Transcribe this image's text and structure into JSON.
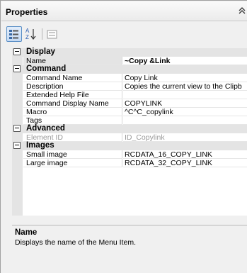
{
  "panel": {
    "title": "Properties"
  },
  "toolbar": {
    "categorized_icon": "categorized-view-icon",
    "alphabetical_icon": "sort-alphabetical-icon",
    "pages_icon": "property-pages-icon"
  },
  "categories": [
    {
      "label": "Display",
      "props": [
        {
          "name": "Name",
          "value": "~Copy &Link",
          "bold": true,
          "selected": true
        }
      ]
    },
    {
      "label": "Command",
      "props": [
        {
          "name": "Command Name",
          "value": "Copy Link"
        },
        {
          "name": "Description",
          "value": "Copies the current view to the Clipb"
        },
        {
          "name": "Extended Help File",
          "value": ""
        },
        {
          "name": "Command Display Name",
          "value": "COPYLINK"
        },
        {
          "name": "Macro",
          "value": "^C^C_copylink"
        },
        {
          "name": "Tags",
          "value": ""
        }
      ]
    },
    {
      "label": "Advanced",
      "props": [
        {
          "name": "Element ID",
          "value": "ID_Copylink",
          "disabled": true
        }
      ]
    },
    {
      "label": "Images",
      "props": [
        {
          "name": "Small image",
          "value": "RCDATA_16_COPY_LINK"
        },
        {
          "name": "Large image",
          "value": "RCDATA_32_COPY_LINK"
        }
      ]
    }
  ],
  "description": {
    "title": "Name",
    "text": "Displays the name of the Menu Item."
  }
}
